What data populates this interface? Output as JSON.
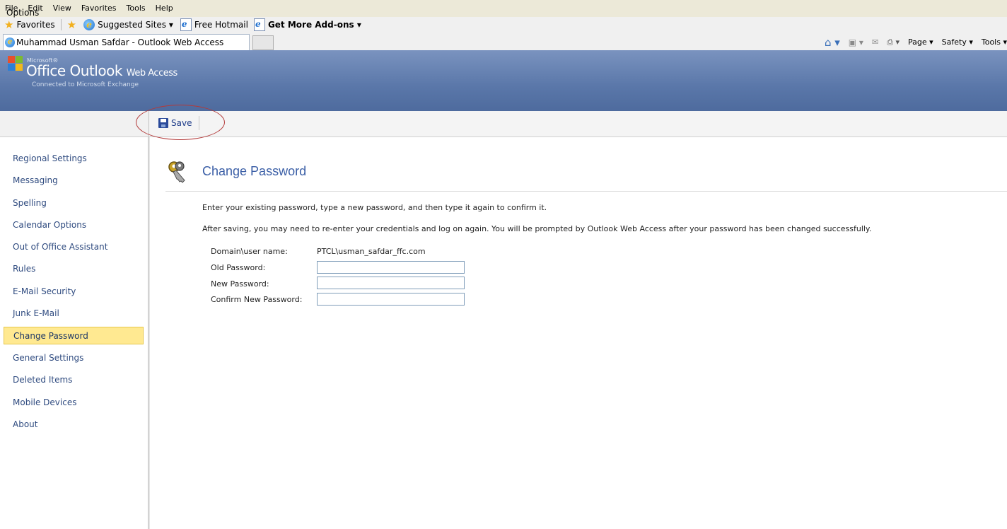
{
  "browser": {
    "menu": [
      "File",
      "Edit",
      "View",
      "Favorites",
      "Tools",
      "Help"
    ],
    "favorites_label": "Favorites",
    "favorites_links": [
      "Suggested Sites ▾",
      "Free Hotmail",
      "Get More Add-ons ▾"
    ],
    "tab_title": "Muhammad Usman Safdar - Outlook Web Access",
    "commands": [
      "Page ▾",
      "Safety ▾",
      "Tools ▾"
    ]
  },
  "owa": {
    "brand_micro": "Microsoft®",
    "brand_title": "Office Outlook",
    "brand_suffix": "Web Access",
    "brand_subtitle": "Connected to Microsoft Exchange",
    "options_label": "Options",
    "toolbar": {
      "save_label": "Save"
    }
  },
  "sidebar": {
    "items": [
      "Regional Settings",
      "Messaging",
      "Spelling",
      "Calendar Options",
      "Out of Office Assistant",
      "Rules",
      "E-Mail Security",
      "Junk E-Mail",
      "Change Password",
      "General Settings",
      "Deleted Items",
      "Mobile Devices",
      "About"
    ],
    "active": "Change Password"
  },
  "main": {
    "title": "Change Password",
    "instruction1": "Enter your existing password, type a new password, and then type it again to confirm it.",
    "instruction2": "After saving, you may need to re-enter your credentials and log on again. You will be prompted by Outlook Web Access after your password has been changed successfully.",
    "fields": {
      "domain_label": "Domain\\user name:",
      "domain_value": "PTCL\\usman_safdar_ffc.com",
      "old_label": "Old Password:",
      "old_value": "",
      "new_label": "New Password:",
      "new_value": "",
      "confirm_label": "Confirm New Password:",
      "confirm_value": ""
    }
  }
}
